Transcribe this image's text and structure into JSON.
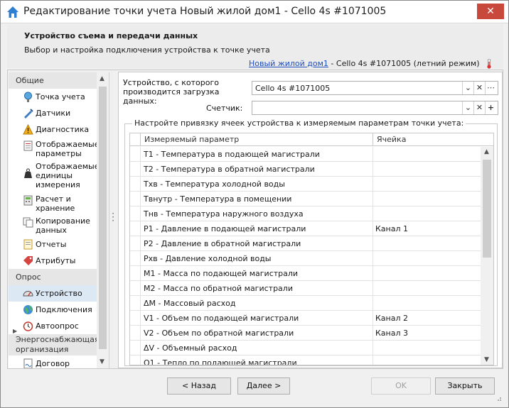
{
  "window": {
    "title": "Редактирование точки учета Новый жилой дом1 - Cello 4s #1071005",
    "close_glyph": "✕"
  },
  "header": {
    "title": "Устройство съема и передачи данных",
    "subtitle": "Выбор и настройка подключения устройства к точке учета",
    "object_link": "Новый жилой дом1",
    "object_rest": " - Cello 4s #1071005 (летний режим)"
  },
  "sidebar": {
    "sections": [
      {
        "label": "Общие",
        "items": [
          {
            "label": "Точка учета",
            "icon": "point-icon"
          },
          {
            "label": "Датчики",
            "icon": "sensor-icon"
          },
          {
            "label": "Диагностика",
            "icon": "warning-icon"
          },
          {
            "label": "Отображаемые параметры",
            "icon": "list-icon"
          },
          {
            "label": "Отображаемые единицы измерения",
            "icon": "weight-icon"
          },
          {
            "label": "Расчет и хранение",
            "icon": "calc-icon"
          },
          {
            "label": "Копирование данных",
            "icon": "copy-icon"
          },
          {
            "label": "Отчеты",
            "icon": "report-icon"
          },
          {
            "label": "Атрибуты",
            "icon": "tag-icon"
          }
        ]
      },
      {
        "label": "Опрос",
        "items": [
          {
            "label": "Устройство",
            "icon": "gauge-icon",
            "selected": true
          },
          {
            "label": "Подключения",
            "icon": "globe-icon"
          },
          {
            "label": "Автоопрос",
            "icon": "clock-icon",
            "expandable": true
          }
        ]
      },
      {
        "label": "Энергоснабжающая организация",
        "items": [
          {
            "label": "Договор",
            "icon": "contract-icon"
          }
        ]
      }
    ]
  },
  "form": {
    "device_label": "Устройство, с которого производится загрузка данных:",
    "device_value": "Cello 4s #1071005",
    "counter_label": "Счетчик:",
    "counter_value": "",
    "group_caption": "Настройте привязку ячеек устройства к измеряемым параметрам точки учета:"
  },
  "grid": {
    "columns": [
      "Измеряемый параметр",
      "Ячейка"
    ],
    "rows": [
      {
        "param": "T1 - Температура в подающей магистрали",
        "cell": ""
      },
      {
        "param": "T2 - Температура в обратной магистрали",
        "cell": ""
      },
      {
        "param": "Тхв - Температура холодной воды",
        "cell": ""
      },
      {
        "param": "Твнутр - Температура в помещении",
        "cell": ""
      },
      {
        "param": "Тнв - Температура наружного воздуха",
        "cell": ""
      },
      {
        "param": "P1 - Давление в подающей магистрали",
        "cell": "Канал 1"
      },
      {
        "param": "P2 - Давление в обратной магистрали",
        "cell": ""
      },
      {
        "param": "Рхв - Давление холодной воды",
        "cell": ""
      },
      {
        "param": "M1 - Масса по подающей магистрали",
        "cell": ""
      },
      {
        "param": "M2 - Масса по обратной магистрали",
        "cell": ""
      },
      {
        "param": "ΔM - Массовый расход",
        "cell": ""
      },
      {
        "param": "V1 - Объем по подающей магистрали",
        "cell": "Канал 2"
      },
      {
        "param": "V2 - Объем по обратной магистрали",
        "cell": "Канал 3"
      },
      {
        "param": "ΔV - Объемный расход",
        "cell": ""
      },
      {
        "param": "Q1 - Тепло по подающей магистрали",
        "cell": ""
      }
    ]
  },
  "buttons": {
    "back": "< Назад",
    "next": "Далее >",
    "ok": "OK",
    "close": "Закрыть"
  }
}
